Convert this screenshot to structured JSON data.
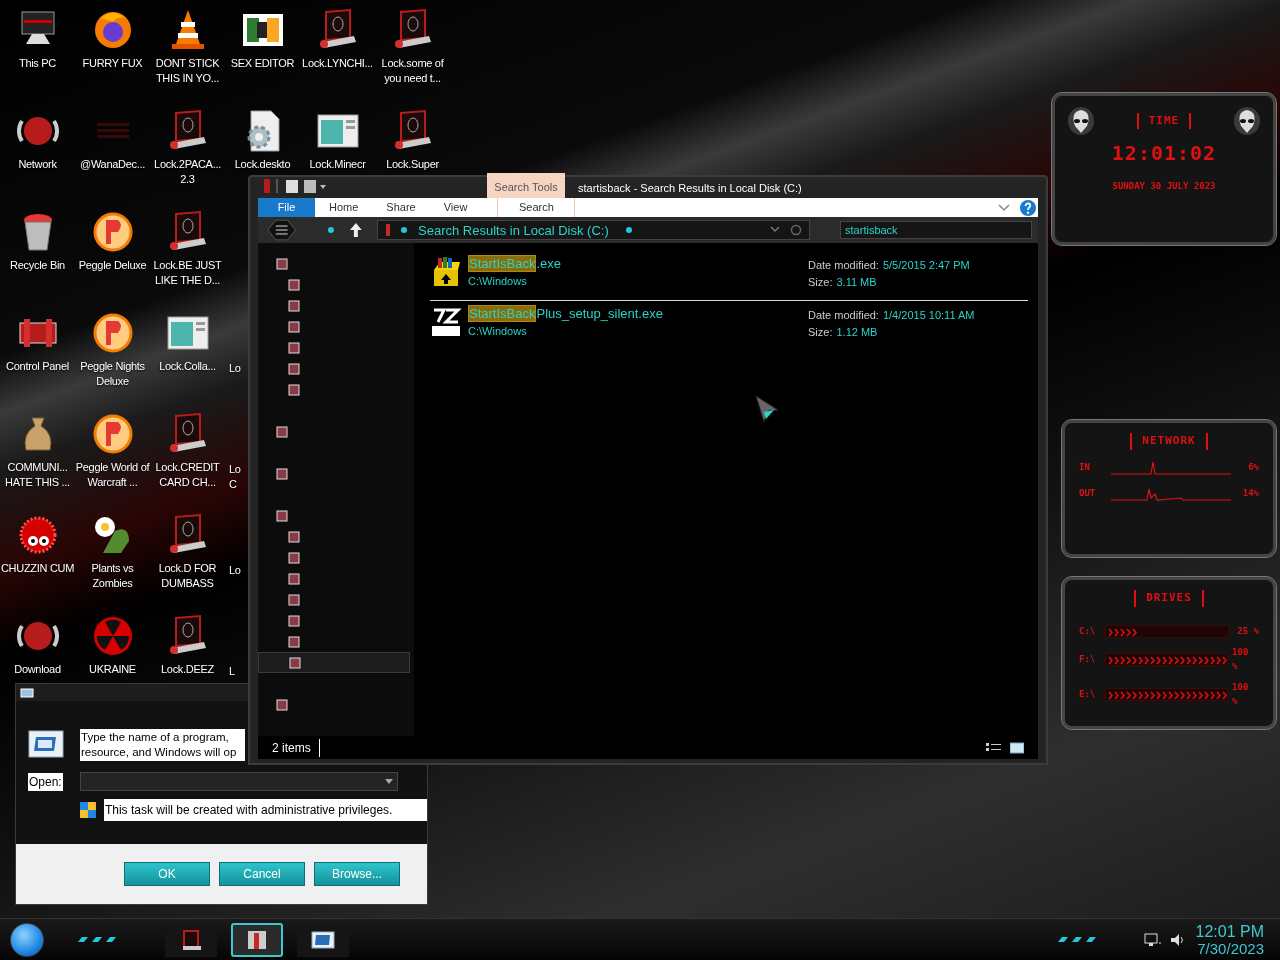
{
  "desktop": {
    "rows": [
      [
        {
          "label": "This PC",
          "kind": "pc"
        },
        {
          "label": "FURRY FUX",
          "kind": "firefox"
        },
        {
          "label": "DONT STICK THIS IN YO...",
          "kind": "cone"
        },
        {
          "label": "SEX EDITOR",
          "kind": "hxd"
        },
        {
          "label": "Lock.LYNCHI...",
          "kind": "lock"
        },
        {
          "label": "Lock.some of you need t...",
          "kind": "lock"
        }
      ],
      [
        {
          "label": "Network",
          "kind": "globe"
        },
        {
          "label": "@WanaDec...",
          "kind": "faded"
        },
        {
          "label": "Lock.2PACA... 2.3",
          "kind": "lock"
        },
        {
          "label": "Lock.deskto",
          "kind": "gear"
        },
        {
          "label": "Lock.Minecr",
          "kind": "window"
        },
        {
          "label": "Lock.Super",
          "kind": "lock"
        }
      ],
      [
        {
          "label": "Recycle Bin",
          "kind": "bin"
        },
        {
          "label": "Peggle Deluxe",
          "kind": "ball"
        },
        {
          "label": "Lock.BE JUST LIKE THE D...",
          "kind": "lock"
        }
      ],
      [
        {
          "label": "Control Panel",
          "kind": "panel"
        },
        {
          "label": "Peggle Nights Deluxe",
          "kind": "ball"
        },
        {
          "label": "Lock.Colla...",
          "kind": "window"
        },
        {
          "label": "Lo",
          "kind": "none"
        }
      ],
      [
        {
          "label": "COMMUNI... HATE THIS ...",
          "kind": "bag"
        },
        {
          "label": "Peggle World of Warcraft ...",
          "kind": "ball"
        },
        {
          "label": "Lock.CREDIT CARD CH...",
          "kind": "lock"
        },
        {
          "label": "Lo C",
          "kind": "none"
        }
      ],
      [
        {
          "label": "CHUZZIN CUM",
          "kind": "fuzzy"
        },
        {
          "label": "Plants vs Zombies",
          "kind": "flower"
        },
        {
          "label": "Lock.D FOR DUMBASS",
          "kind": "lock"
        },
        {
          "label": "Lo",
          "kind": "none"
        }
      ],
      [
        {
          "label": "Download",
          "kind": "globe"
        },
        {
          "label": "UKRAINE",
          "kind": "radiation"
        },
        {
          "label": "Lock.DEEZ",
          "kind": "lock"
        },
        {
          "label": "L",
          "kind": "none"
        }
      ]
    ]
  },
  "explorer": {
    "title": "startisback - Search Results in Local Disk (C:)",
    "context_tab": "Search Tools",
    "ribbon_tabs": [
      {
        "label": "File",
        "selected": true,
        "contextual": false
      },
      {
        "label": "Home",
        "selected": false,
        "contextual": false
      },
      {
        "label": "Share",
        "selected": false,
        "contextual": false
      },
      {
        "label": "View",
        "selected": false,
        "contextual": false
      },
      {
        "label": "Search",
        "selected": false,
        "contextual": true
      }
    ],
    "address": "Search Results in Local Disk (C:)",
    "search": {
      "value": "startisback"
    },
    "nav_pane": [
      {
        "selected": false,
        "children": [
          {
            "selected": false
          },
          {
            "selected": false
          },
          {
            "selected": false
          },
          {
            "selected": false
          },
          {
            "selected": false
          },
          {
            "selected": false
          }
        ]
      },
      {
        "selected": false
      },
      {
        "selected": false
      },
      {
        "selected": false,
        "children": [
          {
            "selected": false
          },
          {
            "selected": false
          },
          {
            "selected": false
          },
          {
            "selected": false
          },
          {
            "selected": false
          },
          {
            "selected": false
          },
          {
            "selected": true
          }
        ]
      },
      {
        "selected": false
      }
    ],
    "results": [
      {
        "kind": "archive",
        "match": "StartIsBack",
        "rest": ".exe",
        "path": "C:\\Windows",
        "date_label": "Date modified:",
        "date": "5/5/2015 2:47 PM",
        "size_label": "Size:",
        "size": "3.11 MB"
      },
      {
        "kind": "sfx",
        "match": "StartIsBack",
        "rest": "Plus_setup_silent.exe",
        "path": "C:\\Windows",
        "date_label": "Date modified:",
        "date": "1/4/2015 10:11 AM",
        "size_label": "Size:",
        "size": "1.12 MB"
      }
    ],
    "status": "2 items"
  },
  "run_dialog": {
    "message_lines": [
      "Type the name of a program,",
      "resource, and Windows will op"
    ],
    "open_label": "Open:",
    "admin_note": "This task will be created with administrative privileges.",
    "buttons": [
      "OK",
      "Cancel",
      "Browse..."
    ]
  },
  "widgets": {
    "time": {
      "title": "TIME",
      "clock": "12:01:02",
      "date": "SUNDAY 30 JULY 2023"
    },
    "network": {
      "title": "NETWORK",
      "rows": [
        {
          "label": "IN",
          "reading": "6%"
        },
        {
          "label": "OUT",
          "reading": "14%"
        }
      ]
    },
    "drives": {
      "title": "DRIVES",
      "rows": [
        {
          "label": "C:\\",
          "level": 0.25,
          "reading": "25 %"
        },
        {
          "label": "F:\\",
          "level": 1,
          "reading": "100 %"
        },
        {
          "label": "E:\\",
          "level": 1,
          "reading": "100 %"
        }
      ]
    }
  },
  "taskbar": {
    "items": [
      {
        "kind": "lock",
        "selected": false
      },
      {
        "kind": "explorer",
        "selected": true
      },
      {
        "kind": "run",
        "selected": false
      }
    ],
    "time": "12:01 PM",
    "date": "7/30/2023"
  }
}
